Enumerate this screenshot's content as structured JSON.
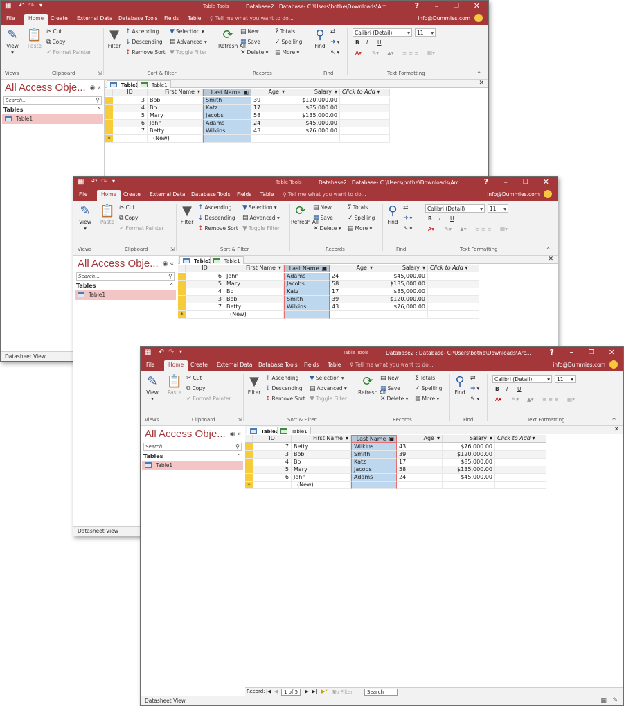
{
  "app": {
    "table_tools": "Table Tools",
    "title": "Database2 : Database- C:\\Users\\bothe\\Downloads\\Arc...",
    "help": "?",
    "minimize": "–",
    "restore": "❐",
    "close": "✕",
    "email": "info@Dummies.com",
    "tell_me": "Tell me what you want to do..."
  },
  "tabs": [
    "File",
    "Home",
    "Create",
    "External Data",
    "Database Tools",
    "Fields",
    "Table"
  ],
  "ribbon": {
    "view": "View",
    "paste": "Paste",
    "cut": "Cut",
    "copy": "Copy",
    "format_painter": "Format Painter",
    "filter": "Filter",
    "ascending": "Ascending",
    "descending": "Descending",
    "remove_sort": "Remove Sort",
    "selection": "Selection",
    "advanced": "Advanced",
    "toggle_filter": "Toggle Filter",
    "refresh_all": "Refresh All",
    "new": "New",
    "save": "Save",
    "delete": "Delete",
    "totals": "Totals",
    "spelling": "Spelling",
    "more": "More",
    "find": "Find",
    "font_name": "Calibri (Detail)",
    "font_size": "11",
    "bold": "B",
    "italic": "I",
    "underline": "U",
    "groups": {
      "views": "Views",
      "clipboard": "Clipboard",
      "sort_filter": "Sort & Filter",
      "records": "Records",
      "find": "Find",
      "text_formatting": "Text Formatting"
    }
  },
  "nav": {
    "title": "All Access Obje...",
    "search_placeholder": "Search...",
    "group": "Tables",
    "item": "Table1"
  },
  "doc_tabs": [
    "Table1",
    "Table1"
  ],
  "columns": [
    "ID",
    "First Name",
    "Last Name",
    "Age",
    "Salary",
    "Click to Add"
  ],
  "new_row": "(New)",
  "windows": [
    {
      "rows": [
        [
          "3",
          "Bob",
          "Smith",
          "39",
          "$120,000.00"
        ],
        [
          "4",
          "Bo",
          "Katz",
          "17",
          "$85,000.00"
        ],
        [
          "5",
          "Mary",
          "Jacobs",
          "58",
          "$135,000.00"
        ],
        [
          "6",
          "John",
          "Adams",
          "24",
          "$45,000.00"
        ],
        [
          "7",
          "Betty",
          "Wilkins",
          "43",
          "$76,000.00"
        ]
      ]
    },
    {
      "rows": [
        [
          "6",
          "John",
          "Adams",
          "24",
          "$45,000.00"
        ],
        [
          "5",
          "Mary",
          "Jacobs",
          "58",
          "$135,000.00"
        ],
        [
          "4",
          "Bo",
          "Katz",
          "17",
          "$85,000.00"
        ],
        [
          "3",
          "Bob",
          "Smith",
          "39",
          "$120,000.00"
        ],
        [
          "7",
          "Betty",
          "Wilkins",
          "43",
          "$76,000.00"
        ]
      ]
    },
    {
      "rows": [
        [
          "7",
          "Betty",
          "Wilkins",
          "43",
          "$76,000.00"
        ],
        [
          "3",
          "Bob",
          "Smith",
          "39",
          "$120,000.00"
        ],
        [
          "4",
          "Bo",
          "Katz",
          "17",
          "$85,000.00"
        ],
        [
          "5",
          "Mary",
          "Jacobs",
          "58",
          "$135,000.00"
        ],
        [
          "6",
          "John",
          "Adams",
          "24",
          "$45,000.00"
        ]
      ]
    }
  ],
  "record_nav": {
    "label": "Record:",
    "first": "⏮",
    "prev": "◀",
    "position": "1 of 5",
    "next": "▶",
    "last": "⏭",
    "new": "▶*",
    "no_filter": "No Filter",
    "search": "Search"
  },
  "status": "Datasheet View"
}
